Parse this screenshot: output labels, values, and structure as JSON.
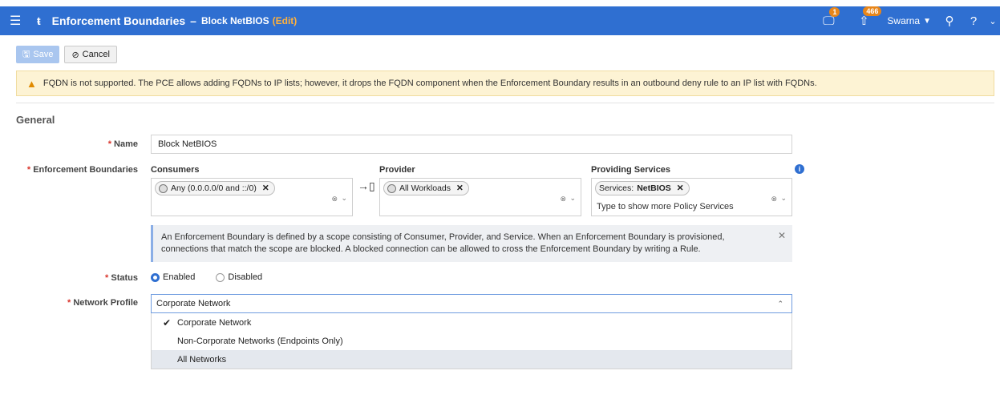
{
  "topbar": {
    "title": "Enforcement Boundaries",
    "separator": "–",
    "subtitle": "Block NetBIOS",
    "edit": "(Edit)",
    "notifications_count": "1",
    "provision_count": "466",
    "user": "Swarna",
    "menu_icon": "menu-icon",
    "logo_icon": "logo-icon"
  },
  "toolbar": {
    "save_label": "Save",
    "cancel_label": "Cancel"
  },
  "warning": {
    "text": "FQDN is not supported. The PCE allows adding FQDNs to IP lists; however, it drops the FQDN component when the Enforcement Boundary results in an outbound deny rule to an IP list with FQDNs."
  },
  "general": {
    "section_title": "General",
    "name_label": "Name",
    "name_value": "Block NetBIOS",
    "eb_label": "Enforcement Boundaries",
    "consumers_label": "Consumers",
    "consumers_chip": "Any (0.0.0.0/0 and ::/0)",
    "provider_label": "Provider",
    "provider_chip": "All Workloads",
    "services_label": "Providing Services",
    "services_chip_prefix": "Services:",
    "services_chip_value": "NetBIOS",
    "services_hint": "Type to show more Policy Services",
    "note_line1": "An Enforcement Boundary is defined by a scope consisting of Consumer, Provider, and Service. When an Enforcement Boundary is provisioned,",
    "note_line2": "connections that match the scope are blocked. A blocked connection can be allowed to cross the Enforcement Boundary by writing a Rule.",
    "status_label": "Status",
    "status_enabled": "Enabled",
    "status_disabled": "Disabled",
    "network_label": "Network Profile",
    "network_value": "Corporate Network",
    "network_options": [
      "Corporate Network",
      "Non-Corporate Networks (Endpoints Only)",
      "All Networks"
    ]
  },
  "colors": {
    "brand": "#2f6fd1",
    "edit": "#ffb13c",
    "warning_bg": "#fdf3d4",
    "badge": "#e8861a"
  }
}
